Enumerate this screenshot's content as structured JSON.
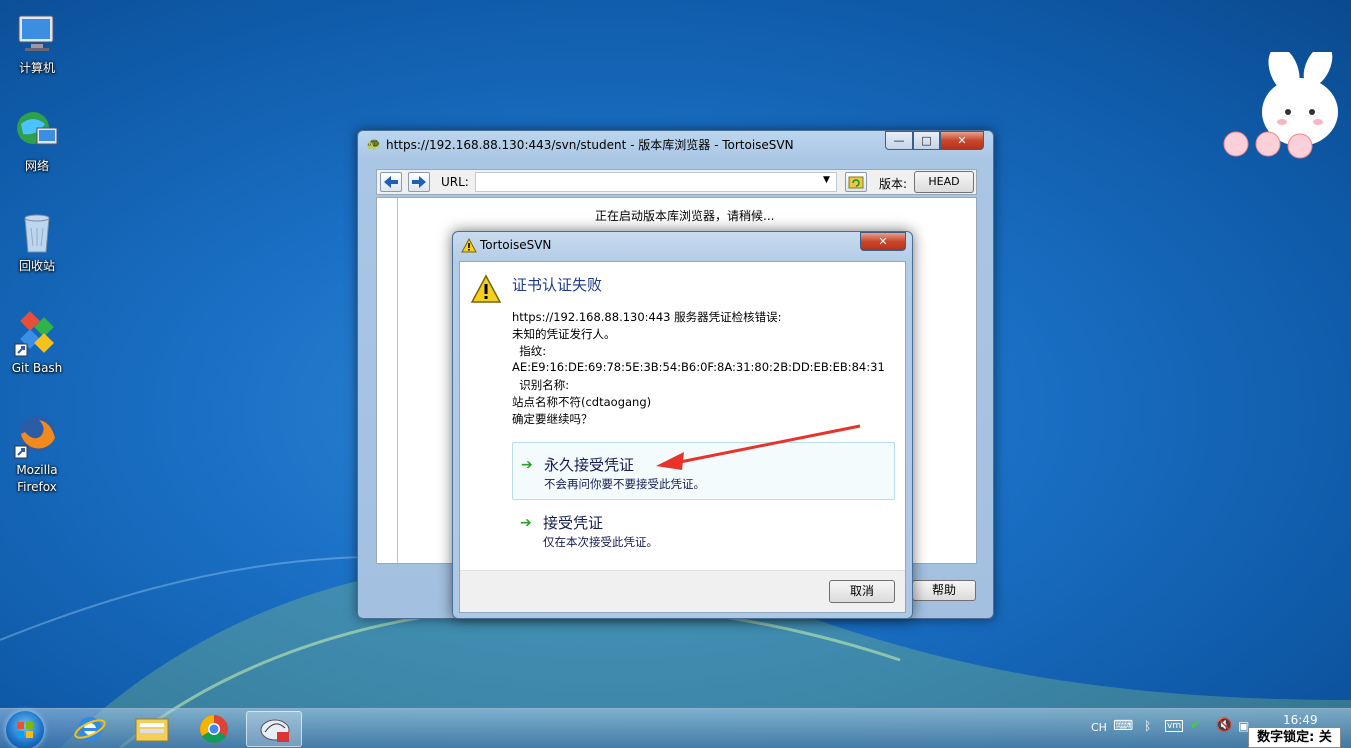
{
  "desktop": {
    "icons": [
      {
        "label": "计算机",
        "icon": "computer-icon"
      },
      {
        "label": "网络",
        "icon": "network-icon"
      },
      {
        "label": "回收站",
        "icon": "recycle-bin-icon"
      },
      {
        "label": "Git Bash",
        "icon": "git-bash-icon"
      },
      {
        "label": "Mozilla Firefox",
        "line1": "Mozilla",
        "line2": "Firefox",
        "icon": "firefox-icon"
      }
    ]
  },
  "repo_browser": {
    "title": "https://192.168.88.130:443/svn/student - 版本库浏览器 - TortoiseSVN",
    "controls": {
      "minimize": "—",
      "maximize": "□",
      "close": "✕"
    },
    "url_label": "URL:",
    "url_value": "",
    "revision_label": "版本:",
    "revision_value": "HEAD",
    "loading_text": "正在启动版本库浏览器，请稍候...",
    "help_button": "帮助"
  },
  "dialog": {
    "title": "TortoiseSVN",
    "main_instruction": "证书认证失败",
    "message_lines": [
      "https://192.168.88.130:443 服务器凭证检核错误:",
      "未知的凭证发行人。",
      "  指纹:",
      "AE:E9:16:DE:69:78:5E:3B:54:B6:0F:8A:31:80:2B:DD:EB:EB:84:31",
      "  识别名称:",
      "站点名称不符(cdtaogang)",
      "确定要继续吗？"
    ],
    "options": [
      {
        "title": "永久接受凭证",
        "note": "不会再问你要不要接受此凭证。"
      },
      {
        "title": "接受凭证",
        "note": "仅在本次接受此凭证。"
      }
    ],
    "cancel_button": "取消",
    "close": "✕"
  },
  "taskbar": {
    "ime": "CH",
    "time": "16:49",
    "numlock": "数字锁定: 关"
  },
  "colors": {
    "accent_arrow": "#e8322a",
    "link_text": "#151c55",
    "instruction_text": "#1e3a8a"
  }
}
